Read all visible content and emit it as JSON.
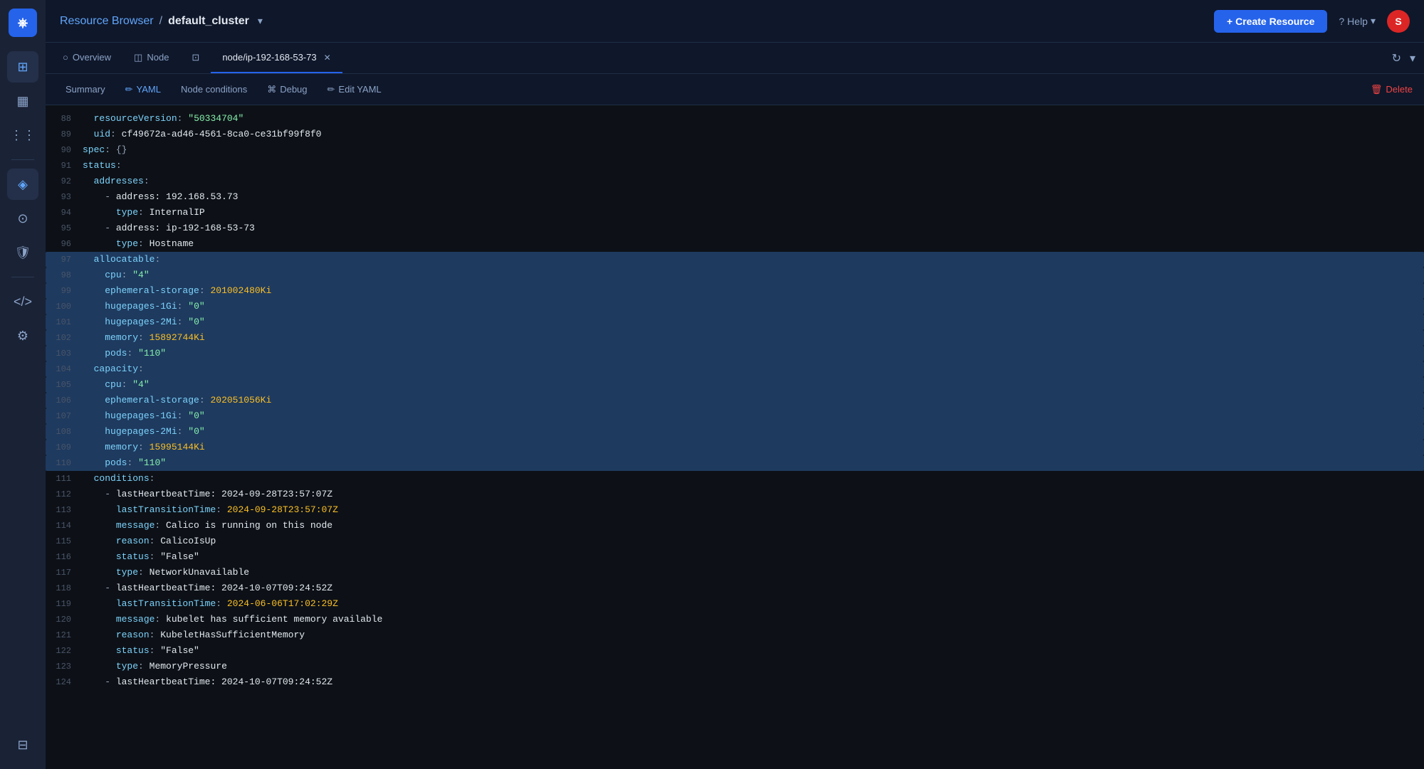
{
  "sidebar": {
    "logo": "K",
    "items": [
      {
        "id": "dashboard",
        "icon": "⊞",
        "label": "Dashboard"
      },
      {
        "id": "grid",
        "icon": "▦",
        "label": "Grid"
      },
      {
        "id": "grid2",
        "icon": "⋮⋮",
        "label": "Grid2"
      },
      {
        "id": "resources",
        "icon": "◈",
        "label": "Resources",
        "active": true
      },
      {
        "id": "settings2",
        "icon": "⚙",
        "label": "Settings2"
      },
      {
        "id": "shield",
        "icon": "🛡",
        "label": "Shield"
      },
      {
        "id": "code",
        "icon": "</>",
        "label": "Code"
      },
      {
        "id": "settings",
        "icon": "⚙",
        "label": "Settings"
      },
      {
        "id": "layers",
        "icon": "⊟",
        "label": "Layers"
      }
    ]
  },
  "header": {
    "breadcrumb_link": "Resource Browser",
    "breadcrumb_sep": "/",
    "breadcrumb_current": "default_cluster",
    "create_button": "+ Create Resource",
    "help_label": "Help",
    "avatar_initial": "S"
  },
  "tabs": {
    "items": [
      {
        "id": "overview",
        "label": "Overview",
        "icon": "○",
        "active": false,
        "closable": false
      },
      {
        "id": "node",
        "label": "Node",
        "icon": "◫",
        "active": false,
        "closable": false
      },
      {
        "id": "resource-icon",
        "label": "",
        "icon": "⊡",
        "active": false,
        "closable": false
      },
      {
        "id": "node-resource",
        "label": "node/ip-192-168-53-73",
        "icon": "",
        "active": true,
        "closable": true
      }
    ]
  },
  "secondary_nav": {
    "items": [
      {
        "id": "summary",
        "label": "Summary",
        "active": false
      },
      {
        "id": "yaml",
        "label": "YAML",
        "icon": "✏",
        "active": true
      },
      {
        "id": "node-conditions",
        "label": "Node conditions",
        "active": false
      },
      {
        "id": "debug",
        "label": "Debug",
        "icon": "⌘",
        "active": false
      },
      {
        "id": "edit-yaml",
        "label": "Edit YAML",
        "icon": "✏",
        "active": false
      }
    ],
    "delete_label": "Delete"
  },
  "code": {
    "lines": [
      {
        "num": 88,
        "content": "  resourceVersion: \"50334704\""
      },
      {
        "num": 89,
        "content": "  uid: cf49672a-ad46-4561-8ca0-ce31bf99f8f0"
      },
      {
        "num": 90,
        "content": "spec: {}"
      },
      {
        "num": 91,
        "content": "status:"
      },
      {
        "num": 92,
        "content": "  addresses:"
      },
      {
        "num": 93,
        "content": "    - address: 192.168.53.73"
      },
      {
        "num": 94,
        "content": "      type: InternalIP"
      },
      {
        "num": 95,
        "content": "    - address: ip-192-168-53-73"
      },
      {
        "num": 96,
        "content": "      type: Hostname"
      },
      {
        "num": 97,
        "content": "  allocatable:",
        "selected": true
      },
      {
        "num": 98,
        "content": "    cpu: \"4\"",
        "selected": true
      },
      {
        "num": 99,
        "content": "    ephemeral-storage: 201002480Ki",
        "selected": true,
        "inline_sel": "201002480Ki"
      },
      {
        "num": 100,
        "content": "    hugepages-1Gi: \"0\"",
        "selected": true
      },
      {
        "num": 101,
        "content": "    hugepages-2Mi: \"0\"",
        "selected": true
      },
      {
        "num": 102,
        "content": "    memory: 15892744Ki",
        "selected": true
      },
      {
        "num": 103,
        "content": "    pods: \"110\"",
        "selected": true
      },
      {
        "num": 104,
        "content": "  capacity:",
        "selected": true
      },
      {
        "num": 105,
        "content": "    cpu: \"4\"",
        "selected": true
      },
      {
        "num": 106,
        "content": "    ephemeral-storage: 202051056Ki",
        "selected": true,
        "inline_sel": "202051056Ki"
      },
      {
        "num": 107,
        "content": "    hugepages-1Gi: \"0\"",
        "selected": true
      },
      {
        "num": 108,
        "content": "    hugepages-2Mi: \"0\"",
        "selected": true
      },
      {
        "num": 109,
        "content": "    memory: 15995144Ki",
        "selected": true
      },
      {
        "num": 110,
        "content": "    pods: \"110\"",
        "selected": true
      },
      {
        "num": 111,
        "content": "  conditions:"
      },
      {
        "num": 112,
        "content": "    - lastHeartbeatTime: 2024-09-28T23:57:07Z"
      },
      {
        "num": 113,
        "content": "      lastTransitionTime: 2024-09-28T23:57:07Z"
      },
      {
        "num": 114,
        "content": "      message: Calico is running on this node"
      },
      {
        "num": 115,
        "content": "      reason: CalicoIsUp"
      },
      {
        "num": 116,
        "content": "      status: \"False\""
      },
      {
        "num": 117,
        "content": "      type: NetworkUnavailable"
      },
      {
        "num": 118,
        "content": "    - lastHeartbeatTime: 2024-10-07T09:24:52Z"
      },
      {
        "num": 119,
        "content": "      lastTransitionTime: 2024-06-06T17:02:29Z"
      },
      {
        "num": 120,
        "content": "      message: kubelet has sufficient memory available"
      },
      {
        "num": 121,
        "content": "      reason: KubeletHasSufficientMemory"
      },
      {
        "num": 122,
        "content": "      status: \"False\""
      },
      {
        "num": 123,
        "content": "      type: MemoryPressure"
      },
      {
        "num": 124,
        "content": "    - lastHeartbeatTime: 2024-10-07T09:24:52Z"
      }
    ]
  }
}
